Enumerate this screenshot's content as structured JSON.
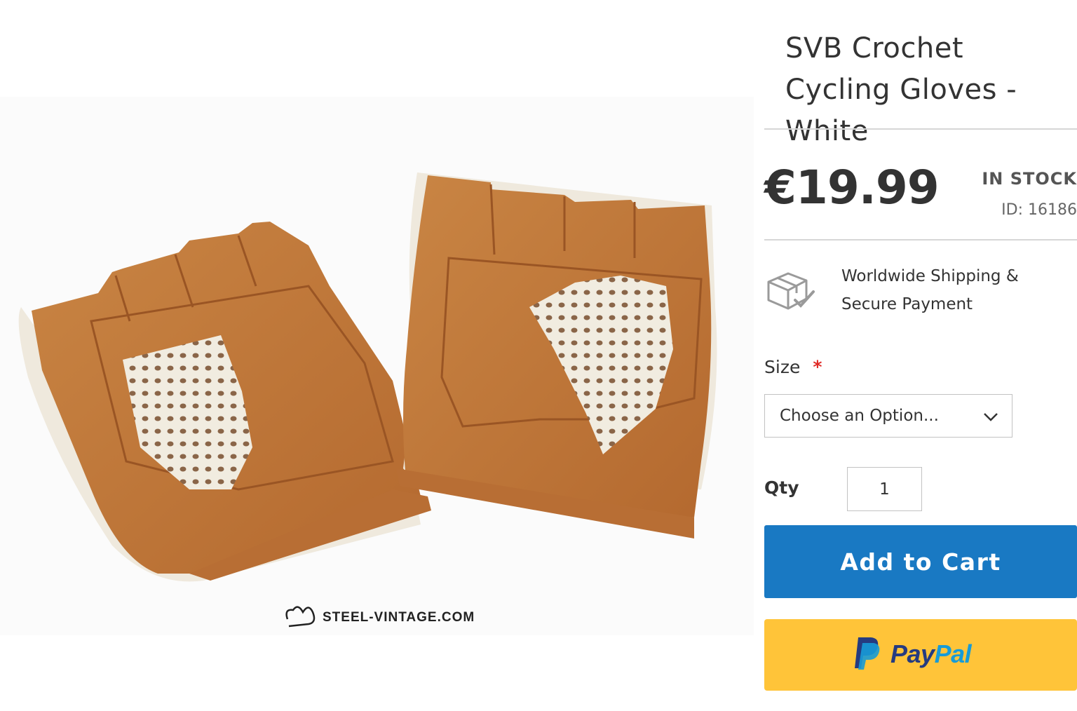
{
  "product": {
    "title": "SVB Crochet Cycling Gloves - White",
    "price": "€19.99",
    "stock_status": "IN STOCK",
    "sku": "ID: 16186",
    "shipping_text": "Worldwide Shipping & Secure Payment",
    "image_watermark": "STEEL-VINTAGE.COM"
  },
  "options": {
    "size_label": "Size",
    "required_mark": "*",
    "size_selected": "Choose an Option...",
    "qty_label": "Qty",
    "qty_value": "1"
  },
  "actions": {
    "add_to_cart": "Add to Cart",
    "paypal_part1": "Pay",
    "paypal_part2": "Pal"
  },
  "icons": {
    "shipping": "box-check-icon",
    "dropdown": "chevron-down-icon",
    "paypal": "paypal-logo-icon",
    "brand": "steel-vintage-logo-icon"
  },
  "colors": {
    "primary_button": "#1979c3",
    "paypal_button": "#ffc439",
    "required": "#e02b27",
    "leather": "#c27a3d"
  }
}
